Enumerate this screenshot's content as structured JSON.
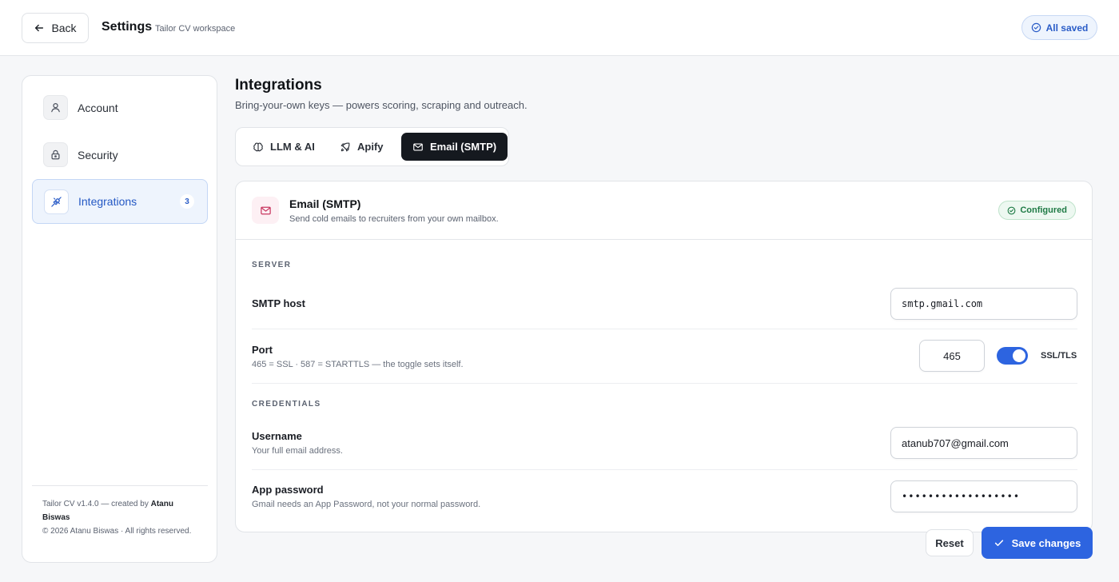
{
  "header": {
    "back_label": "Back",
    "title": "Settings",
    "subtitle": "Tailor CV workspace",
    "status_label": "All saved"
  },
  "sidebar": {
    "items": [
      {
        "label": "Account",
        "icon": "user-icon"
      },
      {
        "label": "Security",
        "icon": "lock-icon"
      },
      {
        "label": "Integrations",
        "icon": "plug-icon",
        "badge": "3",
        "active": true
      }
    ],
    "footer": {
      "line1_prefix": "Tailor CV v1.4.0 — created by ",
      "author": "Atanu Biswas",
      "line2": "© 2026 Atanu Biswas · All rights reserved."
    }
  },
  "main": {
    "title": "Integrations",
    "description": "Bring-your-own keys — powers scoring, scraping and outreach.",
    "tabs": [
      {
        "label": "LLM & AI",
        "icon": "brain-icon"
      },
      {
        "label": "Apify",
        "icon": "rocket-icon"
      },
      {
        "label": "Email (SMTP)",
        "icon": "mail-icon",
        "active": true
      }
    ],
    "card": {
      "title": "Email (SMTP)",
      "description": "Send cold emails to recruiters from your own mailbox.",
      "status": "Configured",
      "server_group": "SERVER",
      "smtp_host_label": "SMTP host",
      "smtp_host_value": "smtp.gmail.com",
      "port_label": "Port",
      "port_help": "465 = SSL · 587 = STARTTLS — the toggle sets itself.",
      "port_value": "465",
      "ssl_label": "SSL/TLS",
      "ssl_enabled": true,
      "credentials_group": "CREDENTIALS",
      "username_label": "Username",
      "username_help": "Your full email address.",
      "username_value": "atanub707@gmail.com",
      "password_label": "App password",
      "password_help": "Gmail needs an App Password, not your normal password.",
      "password_value": "••••••••••••••••••"
    },
    "actions": {
      "reset_label": "Reset",
      "save_label": "Save changes"
    }
  },
  "colors": {
    "accent": "#2d64e0",
    "success": "#1e7a45",
    "active_tab_bg": "#15191f"
  }
}
